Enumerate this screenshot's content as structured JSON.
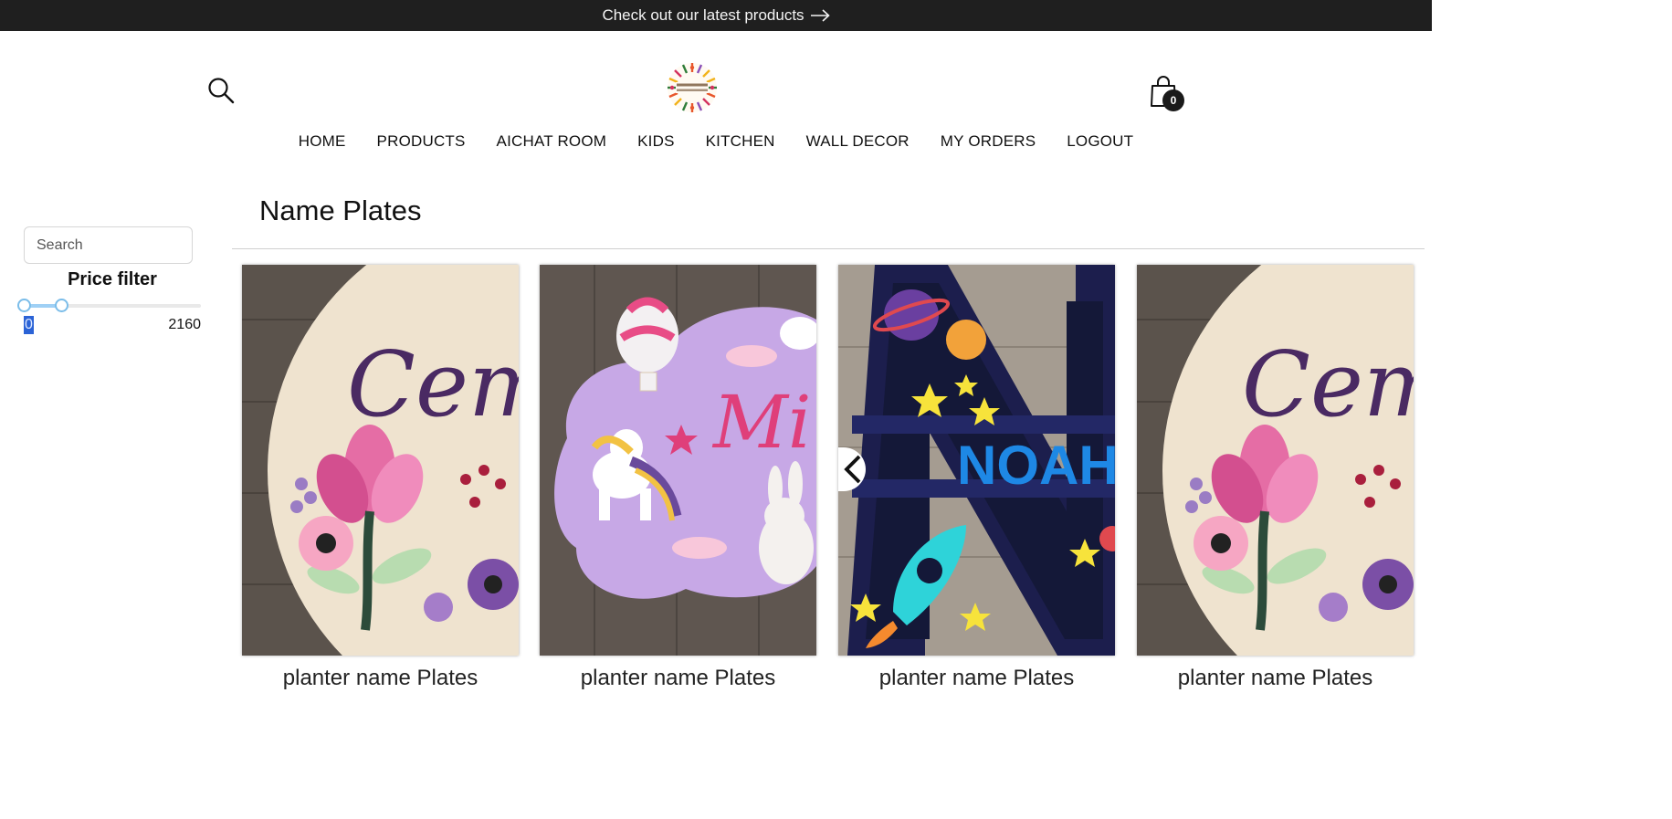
{
  "announcement": {
    "text": "Check out our latest products",
    "icon": "arrow-right-icon"
  },
  "header": {
    "logo_alt": "Shefali's Creative Corner",
    "cart_count": "0"
  },
  "nav": {
    "items": [
      {
        "label": "HOME"
      },
      {
        "label": "PRODUCTS"
      },
      {
        "label": "AICHAT ROOM"
      },
      {
        "label": "KIDS"
      },
      {
        "label": "KITCHEN"
      },
      {
        "label": "WALL DECOR"
      },
      {
        "label": "MY ORDERS"
      },
      {
        "label": "LOGOUT"
      }
    ]
  },
  "sidebar": {
    "search_placeholder": "Search",
    "price_filter_title": "Price filter",
    "price_min": "0",
    "price_max": "2160",
    "slider_low_fraction": 0.0,
    "slider_high_fraction": 0.21
  },
  "main": {
    "title": "Name Plates",
    "products": [
      {
        "name": "planter name Plates",
        "image": "floral-nameplate"
      },
      {
        "name": "planter name Plates",
        "image": "unicorn-cloud-nameplate"
      },
      {
        "name": "planter name Plates",
        "image": "space-letter-nameplate"
      },
      {
        "name": "planter name Plates",
        "image": "floral-nameplate"
      }
    ]
  },
  "colors": {
    "announcement_bg": "#1f1f1f",
    "accent": "#2b63d6",
    "slider": "#7bbde9"
  }
}
